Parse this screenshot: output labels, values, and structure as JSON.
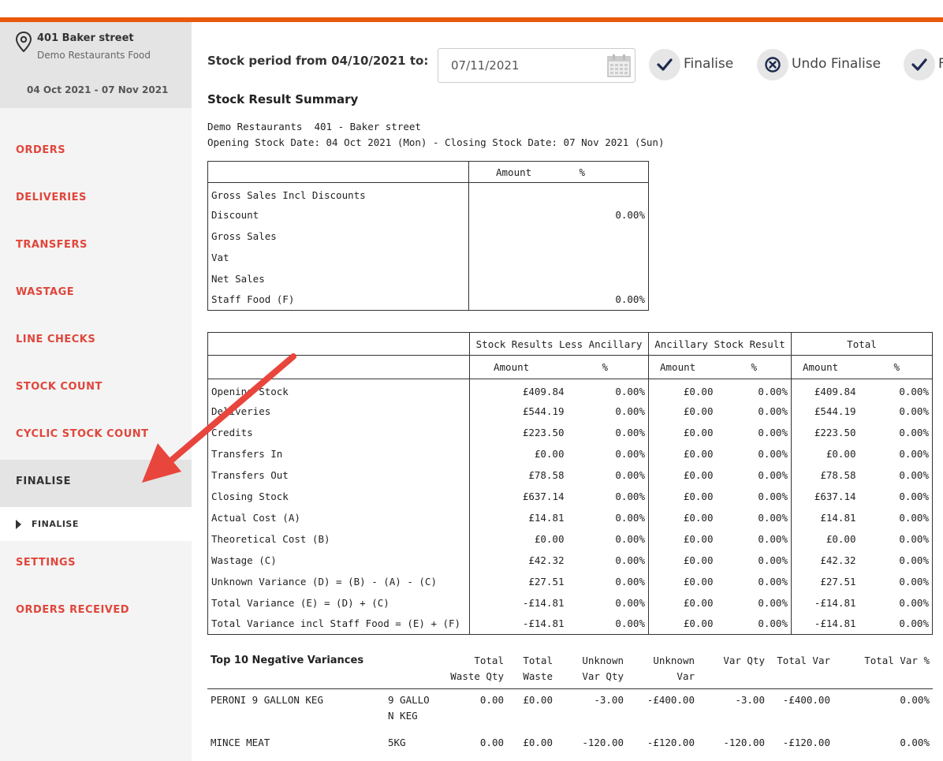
{
  "location": {
    "name": "401 Baker street",
    "subtitle": "Demo Restaurants Food",
    "dates": "04 Oct 2021 - 07 Nov 2021"
  },
  "nav": {
    "items": [
      "ORDERS",
      "DELIVERIES",
      "TRANSFERS",
      "WASTAGE",
      "LINE CHECKS",
      "STOCK COUNT",
      "CYCLIC STOCK COUNT",
      "FINALISE"
    ],
    "sub_item": "FINALISE",
    "items_after": [
      "SETTINGS",
      "ORDERS RECEIVED"
    ]
  },
  "header": {
    "period_label": "Stock period from 04/10/2021 to:",
    "date_value": "07/11/2021",
    "finalise_label": "Finalise",
    "undo_finalise_label": "Undo Finalise",
    "third_action_label": "F"
  },
  "summary": {
    "title": "Stock Result Summary",
    "line1": "Demo Restaurants  401 - Baker street",
    "line2": "Opening Stock Date: 04 Oct 2021 (Mon) - Closing Stock Date: 07 Nov 2021 (Sun)"
  },
  "sales_table": {
    "headers": [
      "",
      "Amount",
      "%"
    ],
    "rows": [
      [
        "Gross Sales Incl Discounts",
        "",
        ""
      ],
      [
        "Discount",
        "",
        "0.00%"
      ],
      [
        "Gross Sales",
        "",
        ""
      ],
      [
        "Vat",
        "",
        ""
      ],
      [
        "Net Sales",
        "",
        ""
      ],
      [
        "Staff Food (F)",
        "",
        "0.00%"
      ]
    ]
  },
  "stock_table": {
    "groups": [
      "Stock Results Less Ancillary",
      "Ancillary Stock Result",
      "Total"
    ],
    "sub_headers": [
      "Amount",
      "%",
      "Amount",
      "%",
      "Amount",
      "%"
    ],
    "rows": [
      [
        "Opening Stock",
        "£409.84",
        "0.00%",
        "£0.00",
        "0.00%",
        "£409.84",
        "0.00%"
      ],
      [
        "Deliveries",
        "£544.19",
        "0.00%",
        "£0.00",
        "0.00%",
        "£544.19",
        "0.00%"
      ],
      [
        "Credits",
        "£223.50",
        "0.00%",
        "£0.00",
        "0.00%",
        "£223.50",
        "0.00%"
      ],
      [
        "Transfers In",
        "£0.00",
        "0.00%",
        "£0.00",
        "0.00%",
        "£0.00",
        "0.00%"
      ],
      [
        "Transfers Out",
        "£78.58",
        "0.00%",
        "£0.00",
        "0.00%",
        "£78.58",
        "0.00%"
      ],
      [
        "Closing Stock",
        "£637.14",
        "0.00%",
        "£0.00",
        "0.00%",
        "£637.14",
        "0.00%"
      ],
      [
        "Actual Cost (A)",
        "£14.81",
        "0.00%",
        "£0.00",
        "0.00%",
        "£14.81",
        "0.00%"
      ],
      [
        "Theoretical Cost (B)",
        "£0.00",
        "0.00%",
        "£0.00",
        "0.00%",
        "£0.00",
        "0.00%"
      ],
      [
        "Wastage (C)",
        "£42.32",
        "0.00%",
        "£0.00",
        "0.00%",
        "£42.32",
        "0.00%"
      ],
      [
        "Unknown Variance (D) = (B) - (A) - (C)",
        "£27.51",
        "0.00%",
        "£0.00",
        "0.00%",
        "£27.51",
        "0.00%"
      ],
      [
        "Total Variance (E) = (D) + (C)",
        "-£14.81",
        "0.00%",
        "£0.00",
        "0.00%",
        "-£14.81",
        "0.00%"
      ],
      [
        "Total Variance incl Staff Food = (E) + (F)",
        "-£14.81",
        "0.00%",
        "£0.00",
        "0.00%",
        "-£14.81",
        "0.00%"
      ]
    ]
  },
  "variances": {
    "title": "Top 10 Negative Variances",
    "headers": [
      "Total Waste Qty",
      "Total Waste",
      "Unknown Var Qty",
      "Unknown Var",
      "Var Qty",
      "Total Var",
      "Total Var %"
    ],
    "rows": [
      [
        "PERONI 9 GALLON KEG",
        "9 GALLO N KEG",
        "0.00",
        "£0.00",
        "-3.00",
        "-£400.00",
        "-3.00",
        "-£400.00",
        "0.00%"
      ],
      [
        "MINCE MEAT",
        "5KG",
        "0.00",
        "£0.00",
        "-120.00",
        "-£120.00",
        "-120.00",
        "-£120.00",
        "0.00%"
      ]
    ]
  },
  "colors": {
    "accent": "#e8590c",
    "nav_text": "#e0463b",
    "arrow": "#e8453c"
  }
}
